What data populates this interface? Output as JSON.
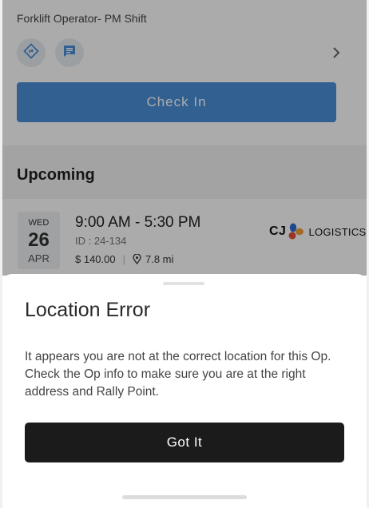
{
  "shift": {
    "title": "Forklift Operator- PM Shift",
    "check_in_label": "Check In"
  },
  "upcoming": {
    "section_title": "Upcoming",
    "card": {
      "day_of_week": "WED",
      "day": "26",
      "month": "APR",
      "time_range": "9:00 AM - 5:30 PM",
      "id_text": "ID : 24-134",
      "pay": "$ 140.00",
      "separator": "|",
      "distance": "7.8 mi",
      "logo_left": "CJ",
      "logo_right": "LOGISTICS"
    }
  },
  "dialog": {
    "title": "Location Error",
    "message": "It appears you are not at the correct location for this Op. Check the Op info to make sure you are at the right address and Rally Point.",
    "button_label": "Got It"
  },
  "icons": {
    "directions": "directions-icon",
    "message": "message-icon",
    "chevron": "chevron-right-icon",
    "location": "location-pin-icon"
  },
  "colors": {
    "primary_blue": "#4a90d9",
    "dialog_button": "#1b1b1b",
    "overlay": "rgba(0,0,0,0.33)"
  }
}
